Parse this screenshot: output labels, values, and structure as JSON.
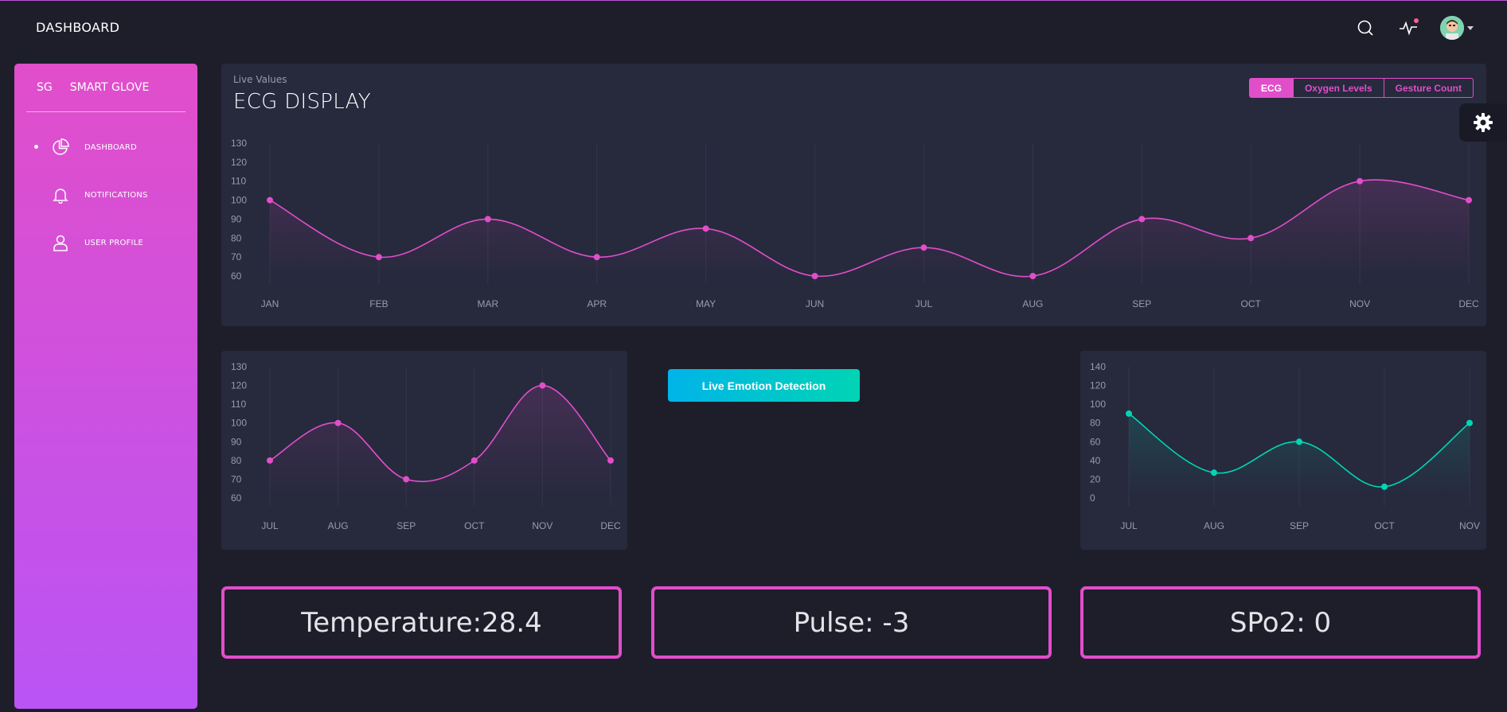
{
  "nav": {
    "title": "DASHBOARD"
  },
  "sidebar": {
    "brand_short": "SG",
    "brand_name": "SMART GLOVE",
    "items": [
      {
        "label": "DASHBOARD",
        "icon": "chart-pie-icon",
        "active": true
      },
      {
        "label": "NOTIFICATIONS",
        "icon": "bell-icon",
        "active": false
      },
      {
        "label": "USER PROFILE",
        "icon": "user-icon",
        "active": false
      }
    ]
  },
  "main_chart": {
    "subtitle": "Live Values",
    "title": "ECG DISPLAY",
    "tabs": [
      "ECG",
      "Oxygen Levels",
      "Gesture Count"
    ],
    "active_tab": "ECG"
  },
  "emotion_button": {
    "label": "Live Emotion Detection"
  },
  "stats": {
    "temperature": "Temperature:28.4",
    "pulse": "Pulse: -3",
    "spo2": "SPo2: 0"
  },
  "colors": {
    "accent": "#e14eca",
    "accent2": "#ba54f5",
    "teal": "#00d6b4",
    "card": "#27293d",
    "bg": "#1e1e2b"
  },
  "chart_data": [
    {
      "type": "line",
      "categories": [
        "JAN",
        "FEB",
        "MAR",
        "APR",
        "MAY",
        "JUN",
        "JUL",
        "AUG",
        "SEP",
        "OCT",
        "NOV",
        "DEC"
      ],
      "values": [
        100,
        70,
        90,
        70,
        85,
        60,
        75,
        60,
        90,
        80,
        110,
        100
      ],
      "yticks": [
        60,
        70,
        80,
        90,
        100,
        110,
        120,
        130
      ],
      "ylim": [
        60,
        130
      ],
      "color": "#e14eca"
    },
    {
      "type": "line",
      "categories": [
        "JUL",
        "AUG",
        "SEP",
        "OCT",
        "NOV",
        "DEC"
      ],
      "values": [
        80,
        100,
        70,
        80,
        120,
        80
      ],
      "yticks": [
        60,
        70,
        80,
        90,
        100,
        110,
        120,
        130
      ],
      "ylim": [
        60,
        130
      ],
      "color": "#e14eca"
    },
    {
      "type": "line",
      "categories": [
        "JUL",
        "AUG",
        "SEP",
        "OCT",
        "NOV"
      ],
      "values": [
        90,
        27,
        60,
        12,
        80
      ],
      "yticks": [
        0,
        20,
        40,
        60,
        80,
        100,
        120,
        140
      ],
      "ylim": [
        0,
        140
      ],
      "color": "#00d6b4"
    }
  ]
}
